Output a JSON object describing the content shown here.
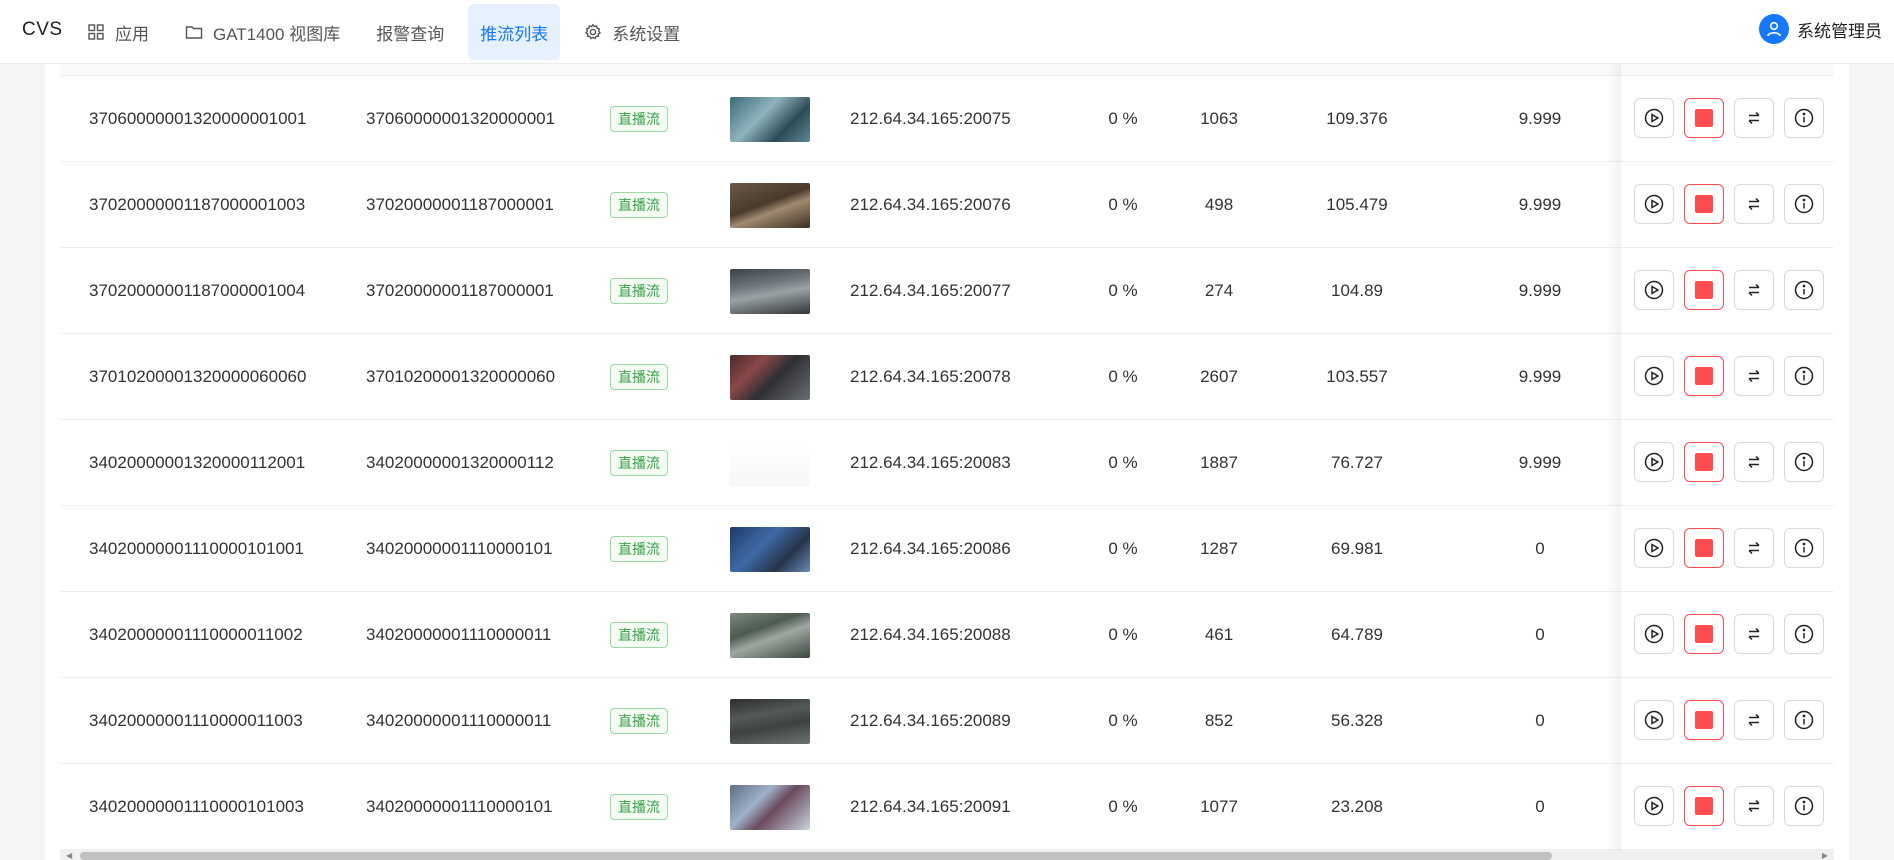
{
  "header": {
    "logo": "CVS",
    "menu": [
      {
        "label": "应用",
        "icon": "grid-icon",
        "active": false
      },
      {
        "label": "GAT1400 视图库",
        "icon": "folder-icon",
        "active": false
      },
      {
        "label": "报警查询",
        "icon": "",
        "active": false
      },
      {
        "label": "推流列表",
        "icon": "",
        "active": true
      },
      {
        "label": "系统设置",
        "icon": "gear-icon",
        "active": false
      }
    ],
    "user": {
      "name": "系统管理员",
      "icon": "user-icon"
    }
  },
  "colors": {
    "accent": "#1677ff",
    "active_bg": "#e7f1fd",
    "danger": "#ff4d4f",
    "tag_green": "#3aa34a"
  },
  "table": {
    "rows": [
      {
        "channel_id": "37060000001320000001001",
        "device_id": "37060000001320000001",
        "stream_type": "直播流",
        "address": "212.64.34.165:20075",
        "loss": "0 %",
        "count": "1063",
        "rate": "109.376",
        "fps": "9.999"
      },
      {
        "channel_id": "37020000001187000001003",
        "device_id": "37020000001187000001",
        "stream_type": "直播流",
        "address": "212.64.34.165:20076",
        "loss": "0 %",
        "count": "498",
        "rate": "105.479",
        "fps": "9.999"
      },
      {
        "channel_id": "37020000001187000001004",
        "device_id": "37020000001187000001",
        "stream_type": "直播流",
        "address": "212.64.34.165:20077",
        "loss": "0 %",
        "count": "274",
        "rate": "104.89",
        "fps": "9.999"
      },
      {
        "channel_id": "37010200001320000060060",
        "device_id": "37010200001320000060",
        "stream_type": "直播流",
        "address": "212.64.34.165:20078",
        "loss": "0 %",
        "count": "2607",
        "rate": "103.557",
        "fps": "9.999"
      },
      {
        "channel_id": "34020000001320000112001",
        "device_id": "34020000001320000112",
        "stream_type": "直播流",
        "address": "212.64.34.165:20083",
        "loss": "0 %",
        "count": "1887",
        "rate": "76.727",
        "fps": "9.999"
      },
      {
        "channel_id": "34020000001110000101001",
        "device_id": "34020000001110000101",
        "stream_type": "直播流",
        "address": "212.64.34.165:20086",
        "loss": "0 %",
        "count": "1287",
        "rate": "69.981",
        "fps": "0"
      },
      {
        "channel_id": "34020000001110000011002",
        "device_id": "34020000001110000011",
        "stream_type": "直播流",
        "address": "212.64.34.165:20088",
        "loss": "0 %",
        "count": "461",
        "rate": "64.789",
        "fps": "0"
      },
      {
        "channel_id": "34020000001110000011003",
        "device_id": "34020000001110000011",
        "stream_type": "直播流",
        "address": "212.64.34.165:20089",
        "loss": "0 %",
        "count": "852",
        "rate": "56.328",
        "fps": "0"
      },
      {
        "channel_id": "34020000001110000101003",
        "device_id": "34020000001110000101",
        "stream_type": "直播流",
        "address": "212.64.34.165:20091",
        "loss": "0 %",
        "count": "1077",
        "rate": "23.208",
        "fps": "0"
      }
    ],
    "actions": [
      {
        "name": "play-icon"
      },
      {
        "name": "stop-icon"
      },
      {
        "name": "switch-icon"
      },
      {
        "name": "info-icon"
      }
    ]
  }
}
